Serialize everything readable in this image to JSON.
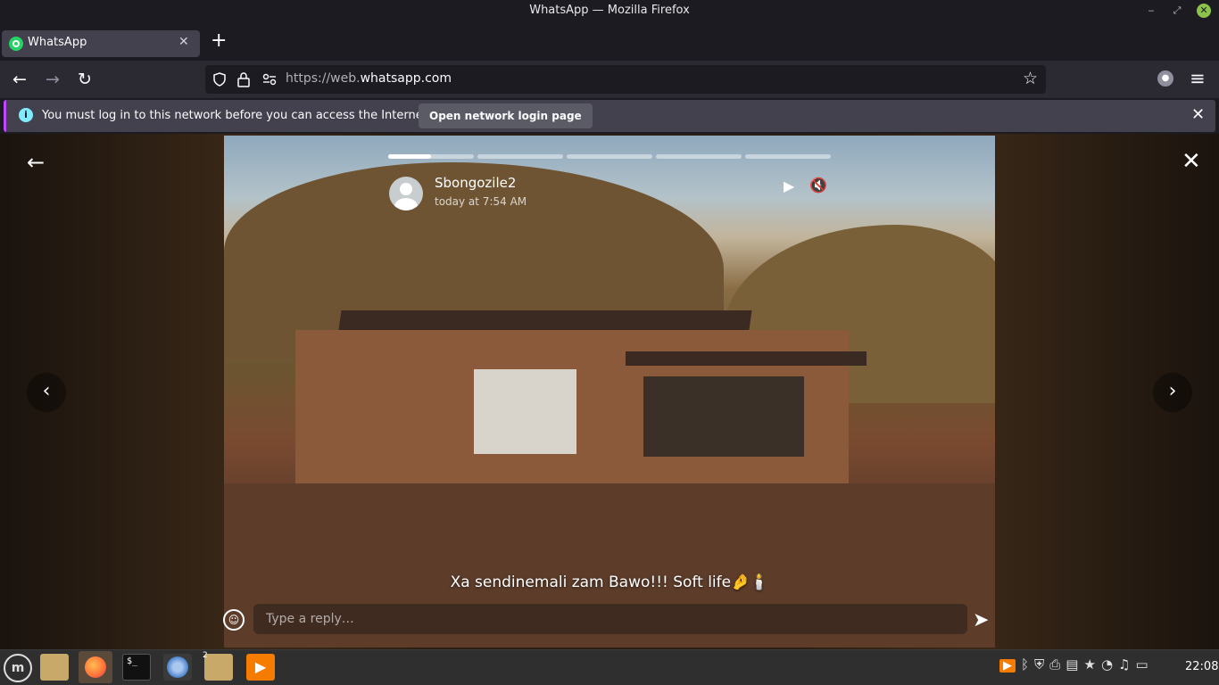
{
  "window": {
    "title": "WhatsApp — Mozilla Firefox",
    "minimize": "‒",
    "maximize": "⤢",
    "close": "✕"
  },
  "tab": {
    "label": "WhatsApp",
    "close": "✕",
    "new_tab": "+"
  },
  "nav": {
    "back": "←",
    "forward": "→",
    "reload": "↻",
    "url_scheme": "https://web.",
    "url_host": "whatsapp.com",
    "bookmark": "☆",
    "menu": "≡",
    "account": "●"
  },
  "notification": {
    "icon": "i",
    "message": "You must log in to this network before you can access the Internet.",
    "button": "Open network login page",
    "close": "✕"
  },
  "status": {
    "author": "Sbongozile2",
    "timestamp": "today at 7:54 AM",
    "caption": "Xa sendinemali zam Bawo!!! Soft life🤌🕯️",
    "reply_placeholder": "Type a reply…",
    "segments": 5,
    "current_segment": 1,
    "current_progress": 0.5,
    "play": "▶",
    "mute": "🔇",
    "back": "←",
    "close": "✕",
    "prev": "‹",
    "next": "›",
    "emoji": "☺",
    "send": "➤"
  },
  "taskbar": {
    "menu": "m",
    "terminal": "$_",
    "files2_count": "2",
    "vlc": "▶",
    "tray_icons": [
      "vlc-icon",
      "bluetooth-icon",
      "shield-icon",
      "printer-icon",
      "notes-icon",
      "star-icon",
      "wifi-icon",
      "music-icon",
      "clipboard-icon"
    ],
    "clock": "22:08"
  }
}
